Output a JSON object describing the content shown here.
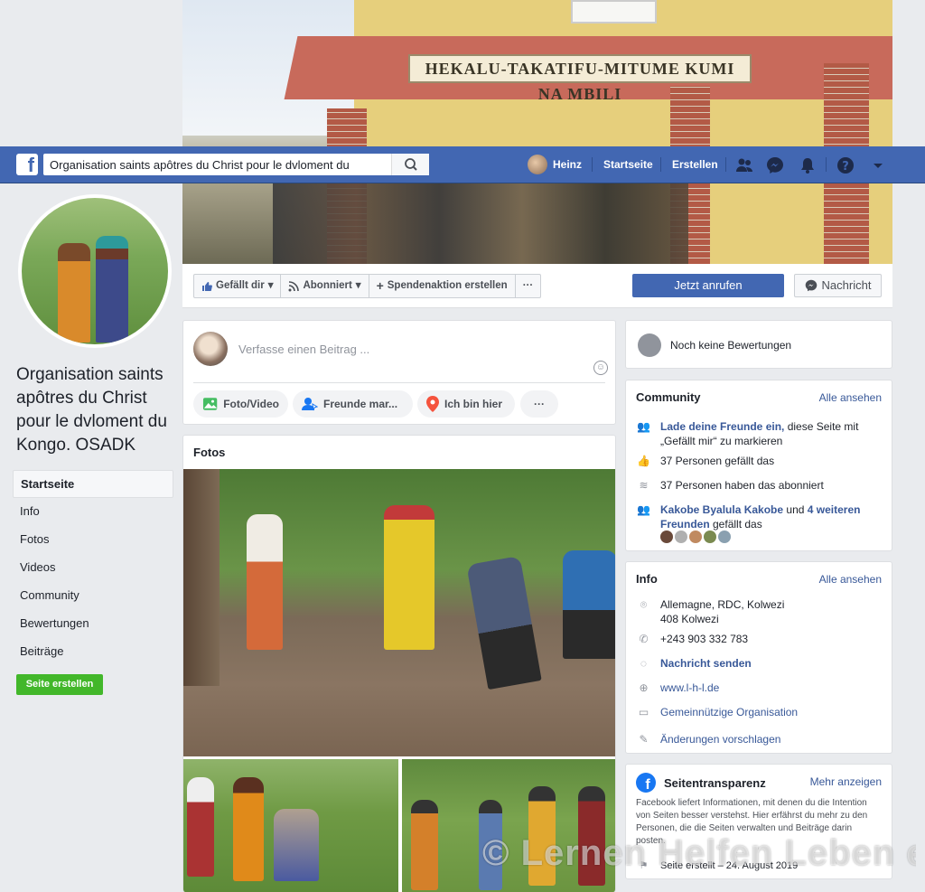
{
  "cover": {
    "sign_text": "HEKALU-TAKATIFU-MITUME KUMI NA MBILI"
  },
  "topbar": {
    "search_value": "Organisation saints apôtres du Christ pour le dvloment du",
    "user_name": "Heinz",
    "home_label": "Startseite",
    "create_label": "Erstellen"
  },
  "page": {
    "name": "Organisation saints apôtres du Christ pour le dvloment du Kongo. OSADK"
  },
  "leftnav": {
    "items": [
      "Startseite",
      "Info",
      "Fotos",
      "Videos",
      "Community",
      "Bewertungen",
      "Beiträge"
    ],
    "create_page": "Seite erstellen"
  },
  "actions": {
    "like": "Gefällt dir",
    "follow": "Abonniert",
    "fundraiser": "Spendenaktion erstellen",
    "more": "···",
    "call": "Jetzt anrufen",
    "message": "Nachricht"
  },
  "composer": {
    "placeholder": "Verfasse einen Beitrag ...",
    "photo_video": "Foto/Video",
    "tag_friends": "Freunde mar...",
    "check_in": "Ich bin hier",
    "more": "···"
  },
  "photos": {
    "title": "Fotos"
  },
  "rating": {
    "text": "Noch keine Bewertungen"
  },
  "community": {
    "title": "Community",
    "see_all": "Alle ansehen",
    "invite_link": "Lade deine Freunde ein,",
    "invite_rest": " diese Seite mit „Gefällt mir“ zu markieren",
    "likes": "37 Personen gefällt das",
    "follows": "37 Personen haben das abonniert",
    "friend_name": "Kakobe Byalula Kakobe",
    "friend_and": " und ",
    "friend_more": "4 weiteren Freunden",
    "friend_rest": " gefällt das"
  },
  "info": {
    "title": "Info",
    "see_all": "Alle ansehen",
    "address_line1": "Allemagne, RDC, Kolwezi",
    "address_line2": "408 Kolwezi",
    "phone": "+243 903 332 783",
    "send_message": "Nachricht senden",
    "website": "www.l-h-l.de",
    "category": "Gemeinnützige Organisation",
    "suggest": "Änderungen vorschlagen"
  },
  "transparency": {
    "title": "Seitentransparenz",
    "more": "Mehr anzeigen",
    "text": "Facebook liefert Informationen, mit denen du die Intention von Seiten besser verstehst. Hier erfährst du mehr zu den Personen, die die Seiten verwalten und Beiträge darin posten.",
    "created": "Seite erstellt – 24. August 2019"
  },
  "watermark": "© Lernen Helfen Leben e.V.",
  "colors": {
    "brand": "#4267b2",
    "link": "#385898",
    "green": "#42b72a"
  }
}
